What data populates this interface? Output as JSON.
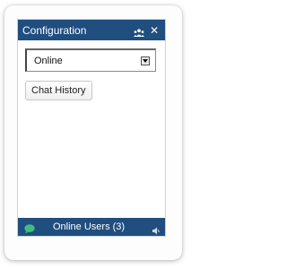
{
  "header": {
    "title": "Configuration",
    "users_icon": "users-icon",
    "close_icon": "close-icon",
    "close_glyph": "✕"
  },
  "status_select": {
    "selected": "Online"
  },
  "chat_history_button": {
    "label": "Chat History"
  },
  "footer": {
    "online_users_label": "Online Users (3)",
    "chat_icon": "chat-bubble-icon",
    "sound_icon": "sound-icon"
  },
  "colors": {
    "bar": "#1f4e7f",
    "chat_icon": "#3fbf7f"
  }
}
